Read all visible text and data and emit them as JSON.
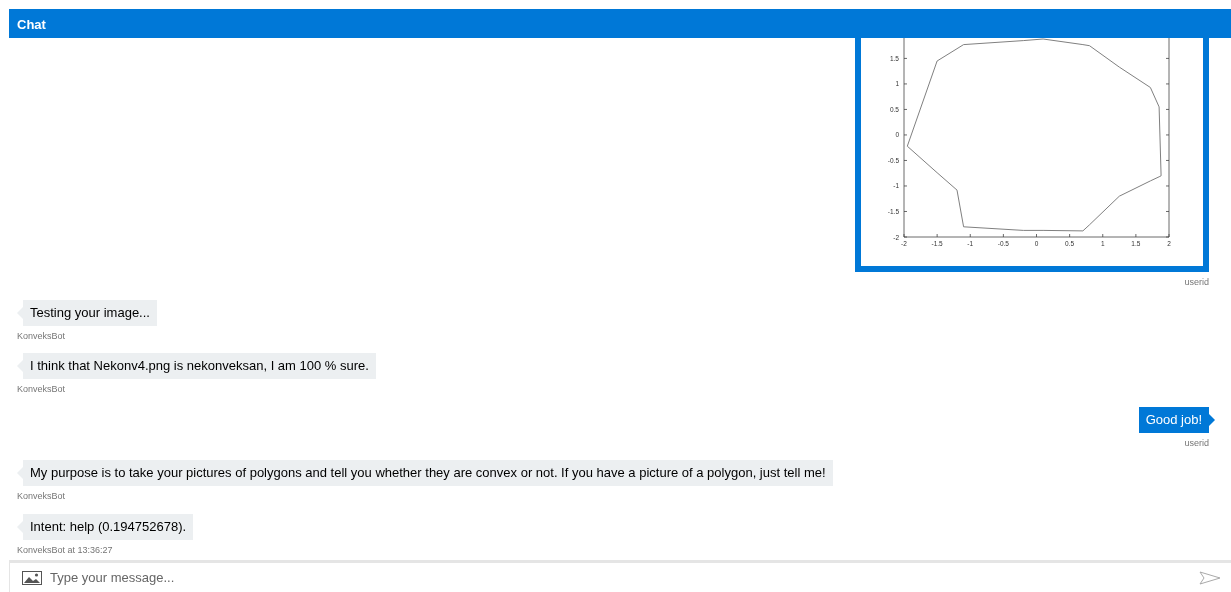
{
  "header": {
    "title": "Chat"
  },
  "messages": [
    {
      "outgoing": true,
      "kind": "image",
      "sender": "userid",
      "chart_data": {
        "type": "line",
        "x": [
          -1.95,
          -1.5,
          -1.2,
          -1.1,
          -0.2,
          0.1,
          0.7,
          0.8,
          1.25,
          1.72,
          1.85,
          1.88
        ],
        "series": [
          {
            "color": "#808080",
            "values": [
              -0.22,
              1.45,
              1.69,
              1.77,
              1.85,
              1.88,
              1.77,
              1.75,
              1.33,
              0.93,
              0.55,
              -0.8
            ]
          },
          {
            "color": "#808080",
            "values": [
              -0.22,
              -0.74,
              -1.08,
              -1.8,
              -1.87,
              -1.87,
              -1.88,
              -1.76,
              -1.2,
              -0.9,
              -0.82,
              -0.8
            ]
          }
        ],
        "xlim": [
          -2,
          2
        ],
        "ylim": [
          -2,
          1.9
        ],
        "xticks": [
          -2,
          -1.5,
          -1,
          -0.5,
          0,
          0.5,
          1,
          1.5,
          2
        ],
        "yticks": [
          -2,
          -1.5,
          -1,
          -0.5,
          0,
          0.5,
          1,
          1.5
        ]
      }
    },
    {
      "outgoing": false,
      "kind": "text",
      "text": "Testing your image...",
      "sender": "KonveksBot"
    },
    {
      "outgoing": false,
      "kind": "text",
      "text": "I think that Nekonv4.png is nekonveksan, I am 100 % sure.",
      "sender": "KonveksBot"
    },
    {
      "outgoing": true,
      "kind": "text",
      "text": "Good job!",
      "sender": "userid"
    },
    {
      "outgoing": false,
      "kind": "text",
      "text": "My purpose is to take your pictures of polygons and tell you whether they are convex or not. If you have a picture of a polygon, just tell me!",
      "sender": "KonveksBot"
    },
    {
      "outgoing": false,
      "kind": "text",
      "text": "Intent: help (0.194752678).",
      "sender": "KonveksBot at 13:36:27"
    }
  ],
  "composer": {
    "placeholder": "Type your message..."
  }
}
